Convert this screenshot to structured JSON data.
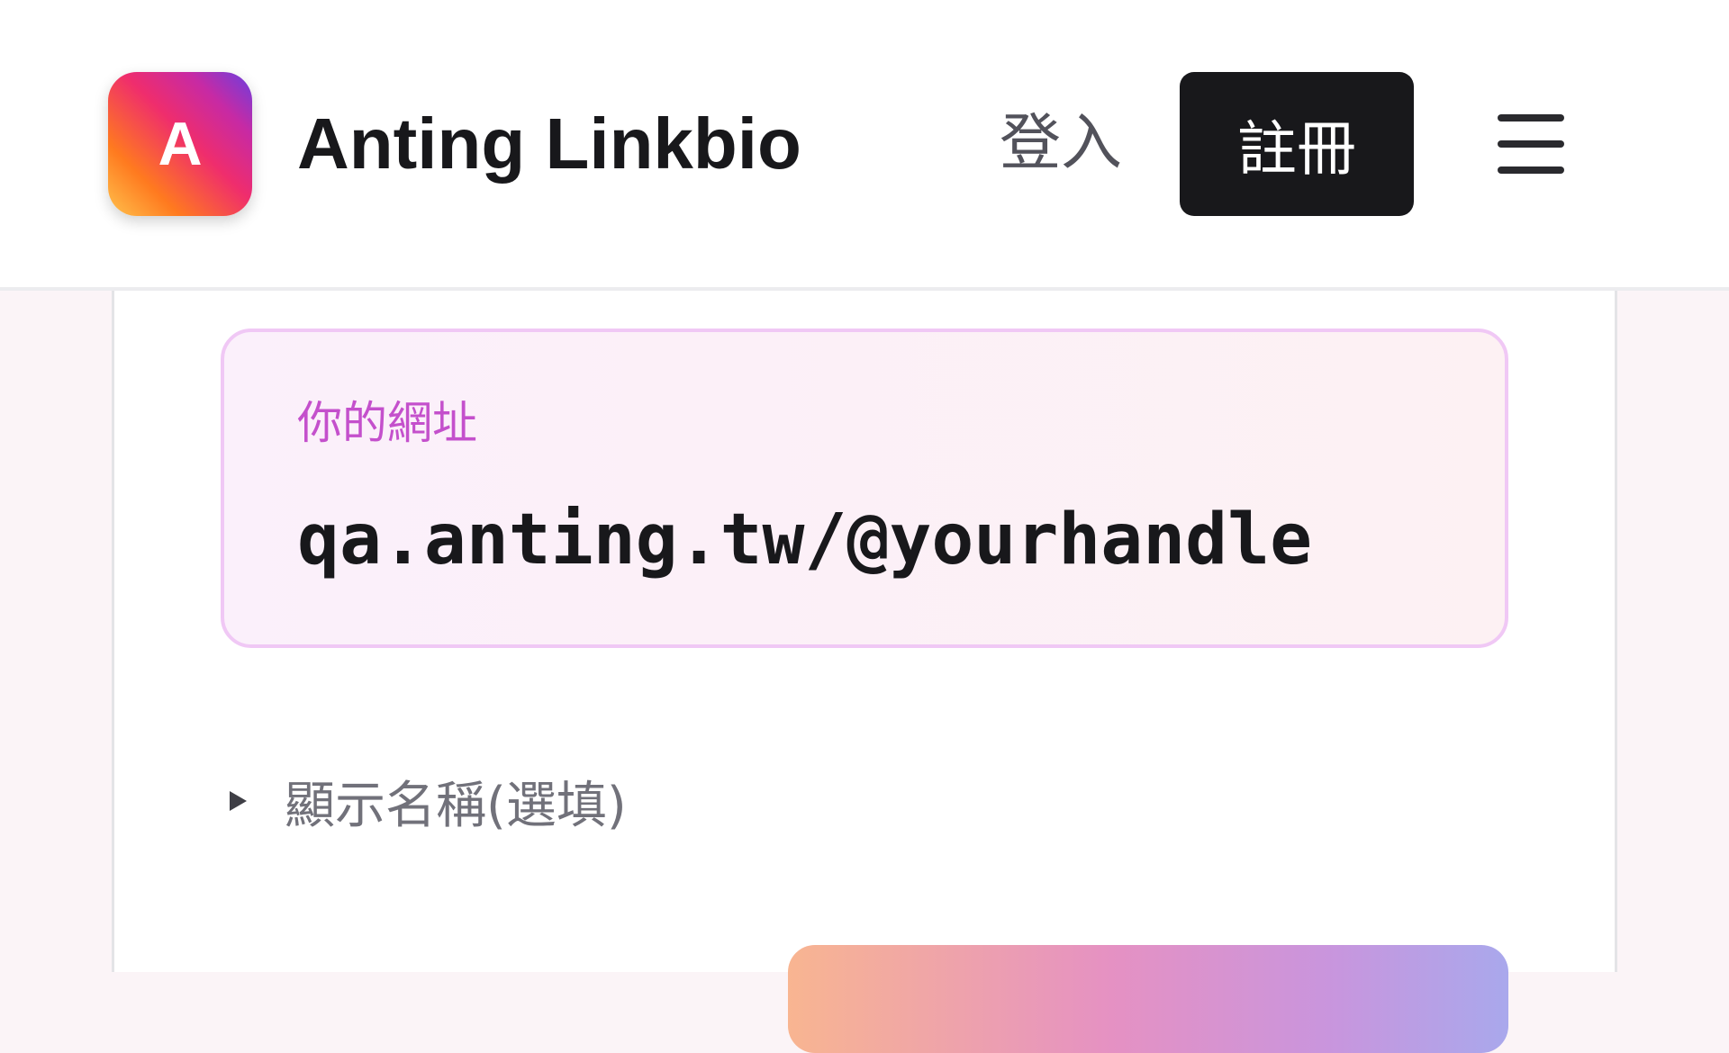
{
  "header": {
    "logo_letter": "A",
    "app_title": "Anting Linkbio",
    "login_label": "登入",
    "signup_label": "註冊",
    "menu_icon": "hamburger-menu-icon"
  },
  "main": {
    "url_label": "你的網址",
    "url_value": "qa.anting.tw/@yourhandle",
    "display_name_toggle": "顯示名稱(選填)"
  },
  "colors": {
    "brand_gradient": [
      "#ffc24d",
      "#ff7a1f",
      "#ef2d6d",
      "#c72aa4",
      "#6a3fe0"
    ],
    "signup_bg": "#18181b",
    "url_label": "#c450cc",
    "url_box_border": "#f0c8f5",
    "cta_gradient": [
      "#f8b591",
      "#e591c3",
      "#c995dd",
      "#a9a8ec"
    ]
  }
}
